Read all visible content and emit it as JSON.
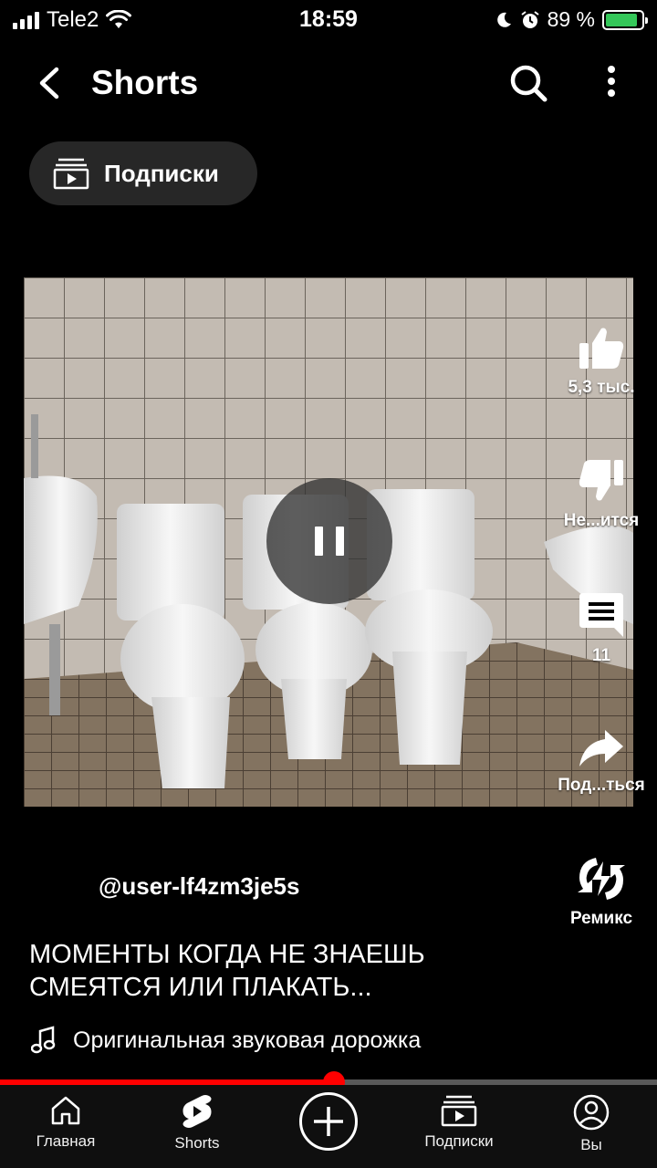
{
  "status_bar": {
    "carrier": "Tele2",
    "time": "18:59",
    "battery_percent": "89 %",
    "battery_level": 0.89,
    "icons": [
      "signal-icon",
      "wifi-icon",
      "moon-icon",
      "alarm-icon",
      "battery-charging-icon"
    ]
  },
  "header": {
    "title": "Shorts",
    "icons": [
      "back-icon",
      "search-icon",
      "more-vertical-icon"
    ]
  },
  "chip": {
    "label": "Подписки",
    "icon": "subscriptions-icon"
  },
  "actions": {
    "like": {
      "label": "5,3 тыс.",
      "icon": "thumbs-up-icon"
    },
    "dislike": {
      "label": "Не...ится",
      "icon": "thumbs-down-icon"
    },
    "comments": {
      "label": "11",
      "icon": "comment-icon"
    },
    "share": {
      "label": "Под...ться",
      "icon": "share-icon"
    },
    "remix": {
      "label": "Ремикс",
      "icon": "remix-icon"
    }
  },
  "video": {
    "state_icon": "pause-icon"
  },
  "meta": {
    "channel": "@user-lf4zm3je5s",
    "caption": "МОМЕНТЫ КОГДА НЕ ЗНАЕШЬ СМЕЯТСЯ ИЛИ ПЛАКАТЬ...",
    "sound": "Оригинальная звуковая дорожка",
    "sound_icon": "music-note-icon"
  },
  "progress": {
    "fraction": 0.508
  },
  "bottom_nav": {
    "items": [
      {
        "label": "Главная",
        "icon": "home-icon"
      },
      {
        "label": "Shorts",
        "icon": "shorts-icon"
      },
      {
        "label": "",
        "icon": "create-plus-icon"
      },
      {
        "label": "Подписки",
        "icon": "subscriptions-icon"
      },
      {
        "label": "Вы",
        "icon": "account-icon"
      }
    ]
  },
  "colors": {
    "accent": "#ff0000",
    "background": "#000000",
    "chip": "#272727",
    "battery": "#34c759"
  }
}
